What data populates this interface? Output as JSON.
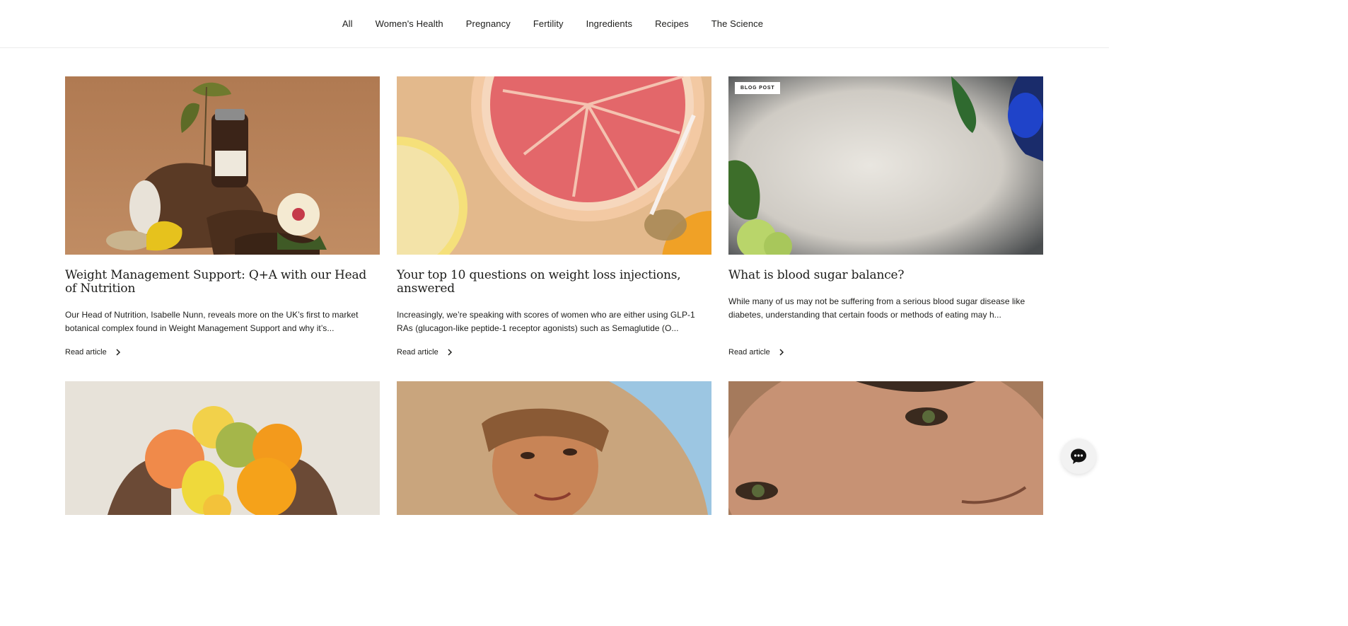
{
  "nav": {
    "items": [
      "All",
      "Women's Health",
      "Pregnancy",
      "Fertility",
      "Ingredients",
      "Recipes",
      "The Science"
    ]
  },
  "articles": [
    {
      "title": "Weight Management Support: Q+A with our Head of Nutrition",
      "excerpt": "Our Head of Nutrition, Isabelle Nunn, reveals more on the UK’s first to market botanical complex found in Weight Management Support and why it’s...",
      "read_more": "Read article",
      "badge": ""
    },
    {
      "title": "Your top 10 questions on weight loss injections, answered",
      "excerpt": "Increasingly, we’re speaking with scores of women who are either using GLP-1 RAs (glucagon-like peptide-1 receptor agonists) such as Semaglutide (O...",
      "read_more": "Read article",
      "badge": ""
    },
    {
      "title": "What is blood sugar balance?",
      "excerpt": "While many of us may not be suffering from a serious blood sugar disease like diabetes, understanding that certain foods or methods of eating may h...",
      "read_more": "Read article",
      "badge": "BLOG POST"
    }
  ],
  "icons": {
    "read_more": "chevron-right-icon",
    "chat": "chat-bubble-icon"
  },
  "colors": {
    "text": "#1d1d1b",
    "divider": "#ececec",
    "chat_bg": "#f2f2f2"
  }
}
